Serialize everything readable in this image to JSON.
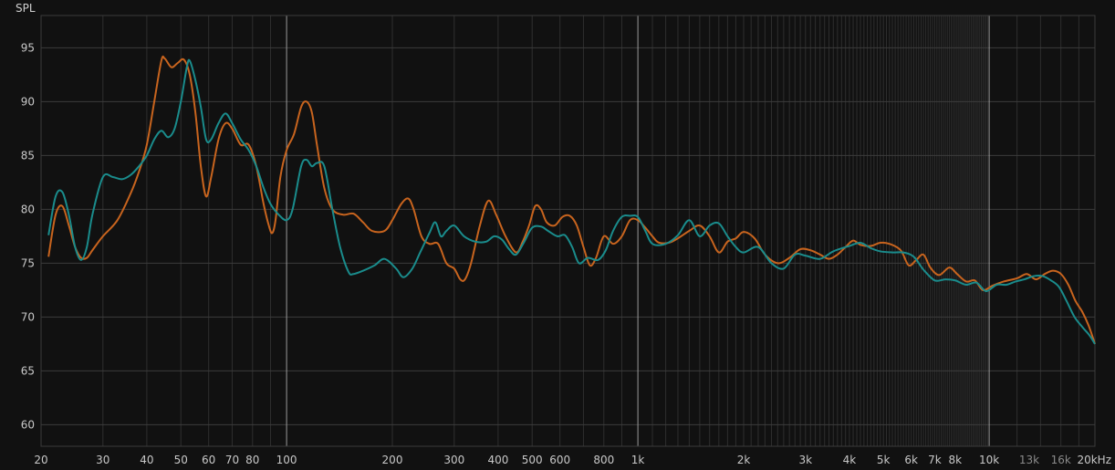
{
  "chart_data": {
    "type": "line",
    "title": "",
    "xlabel": "",
    "ylabel": "SPL",
    "x_scale": "log",
    "xlim": [
      20,
      20000
    ],
    "ylim": [
      58,
      98
    ],
    "grid": true,
    "legend": "none",
    "colors": {
      "background": "#111111",
      "grid_minor": "#2e2e2e",
      "grid_major": "#3c3c3c",
      "grid_decade": "#9a9a9a",
      "tick_text": "#c8c8c8"
    },
    "y_ticks": [
      60,
      65,
      70,
      75,
      80,
      85,
      90,
      95
    ],
    "y_tick_labels": [
      "60",
      "65",
      "70",
      "75",
      "80",
      "85",
      "90",
      "95"
    ],
    "x_ticks": [
      {
        "value": 20,
        "label": "20",
        "dim": false
      },
      {
        "value": 30,
        "label": "30",
        "dim": false
      },
      {
        "value": 40,
        "label": "40",
        "dim": false
      },
      {
        "value": 50,
        "label": "50",
        "dim": false
      },
      {
        "value": 60,
        "label": "60",
        "dim": false
      },
      {
        "value": 70,
        "label": "70",
        "dim": false
      },
      {
        "value": 80,
        "label": "80",
        "dim": false
      },
      {
        "value": 100,
        "label": "100",
        "dim": false
      },
      {
        "value": 200,
        "label": "200",
        "dim": false
      },
      {
        "value": 300,
        "label": "300",
        "dim": false
      },
      {
        "value": 400,
        "label": "400",
        "dim": false
      },
      {
        "value": 500,
        "label": "500",
        "dim": false
      },
      {
        "value": 600,
        "label": "600",
        "dim": false
      },
      {
        "value": 800,
        "label": "800",
        "dim": false
      },
      {
        "value": 1000,
        "label": "1k",
        "dim": false
      },
      {
        "value": 2000,
        "label": "2k",
        "dim": false
      },
      {
        "value": 3000,
        "label": "3k",
        "dim": false
      },
      {
        "value": 4000,
        "label": "4k",
        "dim": false
      },
      {
        "value": 5000,
        "label": "5k",
        "dim": false
      },
      {
        "value": 6000,
        "label": "6k",
        "dim": false
      },
      {
        "value": 7000,
        "label": "7k",
        "dim": false
      },
      {
        "value": 8000,
        "label": "8k",
        "dim": false
      },
      {
        "value": 10000,
        "label": "10k",
        "dim": false
      },
      {
        "value": 13000,
        "label": "13k",
        "dim": true
      },
      {
        "value": 16000,
        "label": "16k",
        "dim": true
      },
      {
        "value": 20000,
        "label": "20kHz",
        "dim": false
      }
    ],
    "series": [
      {
        "color": "#c8641e",
        "points": [
          [
            21,
            75.6
          ],
          [
            22,
            79.5
          ],
          [
            23,
            80.3
          ],
          [
            24,
            78.5
          ],
          [
            25,
            76.5
          ],
          [
            26,
            75.5
          ],
          [
            27,
            75.5
          ],
          [
            28,
            76.2
          ],
          [
            30,
            77.5
          ],
          [
            33,
            79.0
          ],
          [
            36,
            81.5
          ],
          [
            38,
            83.5
          ],
          [
            40,
            86.0
          ],
          [
            42,
            90.0
          ],
          [
            44,
            93.8
          ],
          [
            45,
            94.0
          ],
          [
            47,
            93.2
          ],
          [
            49,
            93.6
          ],
          [
            51,
            93.9
          ],
          [
            53,
            92.5
          ],
          [
            55,
            89.0
          ],
          [
            57,
            84.0
          ],
          [
            59,
            81.2
          ],
          [
            61,
            83.0
          ],
          [
            64,
            86.5
          ],
          [
            67,
            88.0
          ],
          [
            70,
            87.5
          ],
          [
            74,
            86.0
          ],
          [
            78,
            86.0
          ],
          [
            82,
            84.0
          ],
          [
            86,
            80.5
          ],
          [
            89,
            78.5
          ],
          [
            91,
            77.8
          ],
          [
            93,
            79.0
          ],
          [
            96,
            83.0
          ],
          [
            100,
            85.5
          ],
          [
            105,
            87.0
          ],
          [
            110,
            89.5
          ],
          [
            114,
            90.0
          ],
          [
            118,
            89.0
          ],
          [
            122,
            86.0
          ],
          [
            128,
            82.0
          ],
          [
            135,
            80.0
          ],
          [
            145,
            79.5
          ],
          [
            155,
            79.6
          ],
          [
            165,
            78.8
          ],
          [
            175,
            78.0
          ],
          [
            190,
            78.0
          ],
          [
            200,
            79.0
          ],
          [
            212,
            80.5
          ],
          [
            222,
            81.0
          ],
          [
            230,
            80.0
          ],
          [
            242,
            77.5
          ],
          [
            255,
            76.8
          ],
          [
            270,
            76.8
          ],
          [
            285,
            75.0
          ],
          [
            300,
            74.5
          ],
          [
            312,
            73.5
          ],
          [
            322,
            73.5
          ],
          [
            335,
            75.0
          ],
          [
            355,
            78.5
          ],
          [
            375,
            80.8
          ],
          [
            395,
            79.5
          ],
          [
            420,
            77.5
          ],
          [
            450,
            76.0
          ],
          [
            470,
            77.0
          ],
          [
            490,
            78.5
          ],
          [
            510,
            80.3
          ],
          [
            530,
            80.0
          ],
          [
            550,
            78.8
          ],
          [
            580,
            78.5
          ],
          [
            610,
            79.3
          ],
          [
            640,
            79.4
          ],
          [
            670,
            78.5
          ],
          [
            700,
            76.5
          ],
          [
            730,
            74.8
          ],
          [
            760,
            75.5
          ],
          [
            800,
            77.5
          ],
          [
            850,
            76.8
          ],
          [
            900,
            77.5
          ],
          [
            950,
            79.0
          ],
          [
            1000,
            79.0
          ],
          [
            1050,
            78.3
          ],
          [
            1100,
            77.5
          ],
          [
            1150,
            76.9
          ],
          [
            1250,
            77.0
          ],
          [
            1400,
            78.0
          ],
          [
            1500,
            78.5
          ],
          [
            1600,
            77.5
          ],
          [
            1700,
            76.0
          ],
          [
            1800,
            77.0
          ],
          [
            1900,
            77.3
          ],
          [
            2000,
            77.9
          ],
          [
            2150,
            77.3
          ],
          [
            2300,
            75.8
          ],
          [
            2500,
            75.0
          ],
          [
            2700,
            75.5
          ],
          [
            2900,
            76.3
          ],
          [
            3100,
            76.2
          ],
          [
            3300,
            75.8
          ],
          [
            3500,
            75.4
          ],
          [
            3700,
            75.8
          ],
          [
            3900,
            76.5
          ],
          [
            4100,
            77.1
          ],
          [
            4300,
            76.7
          ],
          [
            4600,
            76.6
          ],
          [
            4900,
            76.9
          ],
          [
            5200,
            76.8
          ],
          [
            5600,
            76.2
          ],
          [
            5900,
            74.8
          ],
          [
            6200,
            75.3
          ],
          [
            6500,
            75.8
          ],
          [
            6800,
            74.6
          ],
          [
            7200,
            73.9
          ],
          [
            7700,
            74.6
          ],
          [
            8100,
            74.0
          ],
          [
            8600,
            73.3
          ],
          [
            9100,
            73.4
          ],
          [
            9600,
            72.5
          ],
          [
            10200,
            72.9
          ],
          [
            11000,
            73.3
          ],
          [
            12000,
            73.6
          ],
          [
            12800,
            74.0
          ],
          [
            13600,
            73.5
          ],
          [
            14400,
            74.0
          ],
          [
            15200,
            74.3
          ],
          [
            16000,
            74.0
          ],
          [
            16800,
            73.0
          ],
          [
            17600,
            71.5
          ],
          [
            18400,
            70.5
          ],
          [
            19200,
            69.2
          ],
          [
            20000,
            67.5
          ]
        ]
      },
      {
        "color": "#1a8c8c",
        "points": [
          [
            21,
            77.6
          ],
          [
            22,
            81.2
          ],
          [
            23,
            81.6
          ],
          [
            24,
            79.5
          ],
          [
            25,
            76.5
          ],
          [
            26,
            75.3
          ],
          [
            27,
            76.5
          ],
          [
            28,
            79.5
          ],
          [
            30,
            83.0
          ],
          [
            32,
            83.0
          ],
          [
            34,
            82.8
          ],
          [
            36,
            83.2
          ],
          [
            38,
            84.0
          ],
          [
            40,
            85.0
          ],
          [
            42,
            86.5
          ],
          [
            44,
            87.3
          ],
          [
            46,
            86.7
          ],
          [
            48,
            87.5
          ],
          [
            50,
            90.0
          ],
          [
            52,
            93.2
          ],
          [
            53,
            93.8
          ],
          [
            55,
            92.0
          ],
          [
            57,
            89.5
          ],
          [
            59,
            86.5
          ],
          [
            61,
            86.5
          ],
          [
            64,
            88.0
          ],
          [
            67,
            88.9
          ],
          [
            70,
            88.0
          ],
          [
            74,
            86.5
          ],
          [
            78,
            85.5
          ],
          [
            82,
            84.0
          ],
          [
            86,
            82.0
          ],
          [
            90,
            80.5
          ],
          [
            95,
            79.5
          ],
          [
            100,
            79.0
          ],
          [
            104,
            80.0
          ],
          [
            110,
            84.0
          ],
          [
            114,
            84.6
          ],
          [
            118,
            84.0
          ],
          [
            122,
            84.3
          ],
          [
            128,
            84.0
          ],
          [
            135,
            80.0
          ],
          [
            142,
            76.5
          ],
          [
            150,
            74.2
          ],
          [
            155,
            74.0
          ],
          [
            165,
            74.3
          ],
          [
            178,
            74.8
          ],
          [
            190,
            75.4
          ],
          [
            205,
            74.5
          ],
          [
            215,
            73.7
          ],
          [
            228,
            74.5
          ],
          [
            240,
            76.0
          ],
          [
            255,
            77.8
          ],
          [
            265,
            78.8
          ],
          [
            275,
            77.5
          ],
          [
            285,
            78.0
          ],
          [
            300,
            78.5
          ],
          [
            320,
            77.5
          ],
          [
            345,
            77.0
          ],
          [
            370,
            77.0
          ],
          [
            390,
            77.5
          ],
          [
            410,
            77.2
          ],
          [
            430,
            76.3
          ],
          [
            450,
            75.8
          ],
          [
            475,
            77.0
          ],
          [
            500,
            78.3
          ],
          [
            530,
            78.4
          ],
          [
            555,
            78.0
          ],
          [
            590,
            77.5
          ],
          [
            620,
            77.6
          ],
          [
            650,
            76.5
          ],
          [
            680,
            75.0
          ],
          [
            720,
            75.5
          ],
          [
            770,
            75.3
          ],
          [
            810,
            76.2
          ],
          [
            850,
            78.0
          ],
          [
            900,
            79.3
          ],
          [
            950,
            79.4
          ],
          [
            1000,
            79.3
          ],
          [
            1050,
            78.0
          ],
          [
            1100,
            76.8
          ],
          [
            1200,
            76.8
          ],
          [
            1300,
            77.6
          ],
          [
            1400,
            79.0
          ],
          [
            1500,
            77.5
          ],
          [
            1600,
            78.5
          ],
          [
            1700,
            78.7
          ],
          [
            1800,
            77.5
          ],
          [
            1900,
            76.5
          ],
          [
            2000,
            76.0
          ],
          [
            2200,
            76.5
          ],
          [
            2400,
            75.0
          ],
          [
            2600,
            74.5
          ],
          [
            2800,
            75.8
          ],
          [
            3000,
            75.7
          ],
          [
            3300,
            75.4
          ],
          [
            3600,
            76.1
          ],
          [
            4000,
            76.6
          ],
          [
            4300,
            76.9
          ],
          [
            4600,
            76.4
          ],
          [
            4900,
            76.1
          ],
          [
            5300,
            76.0
          ],
          [
            5700,
            76.0
          ],
          [
            6100,
            75.6
          ],
          [
            6500,
            74.4
          ],
          [
            7000,
            73.4
          ],
          [
            7500,
            73.5
          ],
          [
            8000,
            73.4
          ],
          [
            8600,
            73.0
          ],
          [
            9200,
            73.2
          ],
          [
            9800,
            72.4
          ],
          [
            10500,
            73.0
          ],
          [
            11200,
            73.0
          ],
          [
            11900,
            73.3
          ],
          [
            12600,
            73.5
          ],
          [
            13400,
            73.8
          ],
          [
            14200,
            73.8
          ],
          [
            15000,
            73.4
          ],
          [
            15800,
            72.8
          ],
          [
            16600,
            71.5
          ],
          [
            17500,
            70.0
          ],
          [
            18500,
            69.0
          ],
          [
            19300,
            68.3
          ],
          [
            20000,
            67.5
          ]
        ]
      }
    ]
  }
}
